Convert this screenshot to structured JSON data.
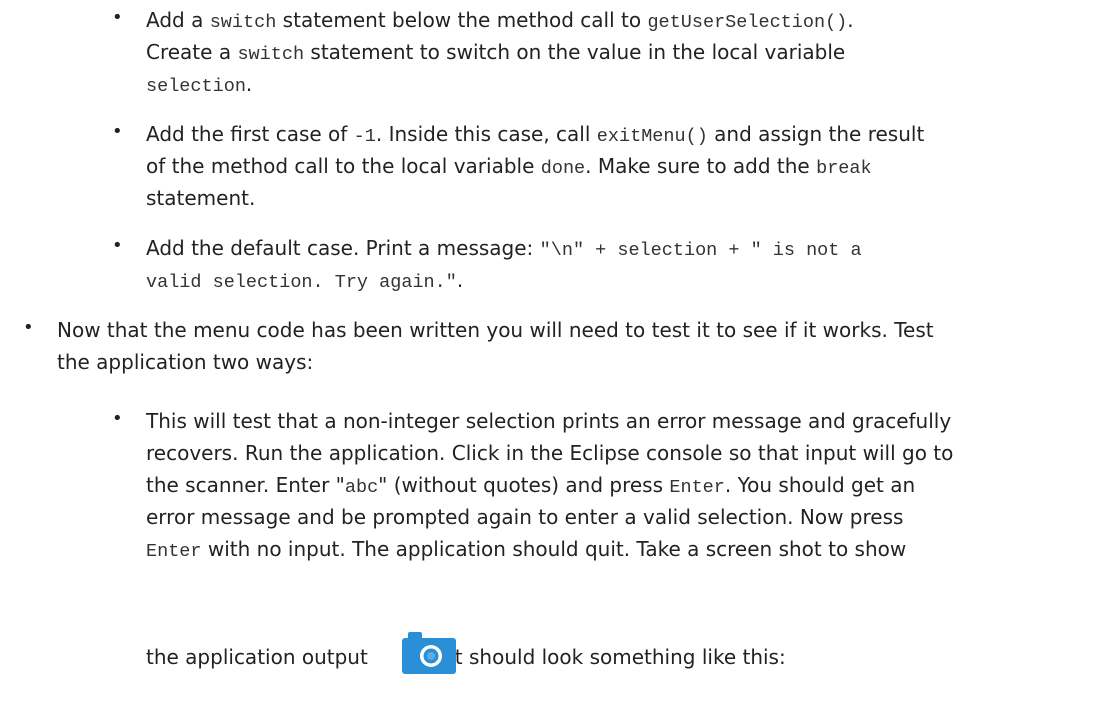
{
  "bullet_symbol": "•",
  "items": {
    "switch": {
      "l1_a": "Add a ",
      "l1_code1": "switch",
      "l1_b": " statement below the method call to ",
      "l1_code2": "getUserSelection()",
      "l1_c": ".",
      "l2_a": "Create a ",
      "l2_code": "switch",
      "l2_b": " statement to switch on the value in the local variable",
      "l3_code": "selection",
      "l3_b": "."
    },
    "first_case": {
      "l1_a": "Add the first case of ",
      "l1_code1": "-1",
      "l1_b": ". Inside this case, call ",
      "l1_code2": "exitMenu()",
      "l1_c": " and assign the result",
      "l2_a": "of the method call to the local variable ",
      "l2_code1": "done",
      "l2_b": ". Make sure to add the ",
      "l2_code2": "break",
      "l3_a": "statement."
    },
    "default_case": {
      "l1_a": "Add the default case. Print a message: ",
      "l1_code": "\"\\n\" + selection + \" is not a",
      "l2_code": "valid selection. Try again.\"",
      "l2_b": "."
    },
    "test": {
      "l1": "Now that the menu code has been written you will need to test it to see if it works. Test",
      "l2": "the application two ways:"
    },
    "non_integer": {
      "l1": "This will test that a non-integer selection prints an error message and gracefully",
      "l2": "recovers. Run the application. Click in the Eclipse console so that input will go to",
      "l3_a": "the scanner. Enter \"",
      "l3_code1": "abc",
      "l3_b": "\" (without quotes) and press ",
      "l3_code2": "Enter",
      "l3_c": ". You should get an",
      "l4": "error message and be prompted again to enter a valid selection. Now press",
      "l5_code": "Enter",
      "l5_b": " with no input. The application should quit. Take a screen shot to show",
      "l6_a": "the application output ",
      "l6_b": ". It should look something like this:"
    }
  },
  "camera_icon": "camera-icon",
  "colors": {
    "camera": "#2a8fd6",
    "text": "#222222"
  }
}
